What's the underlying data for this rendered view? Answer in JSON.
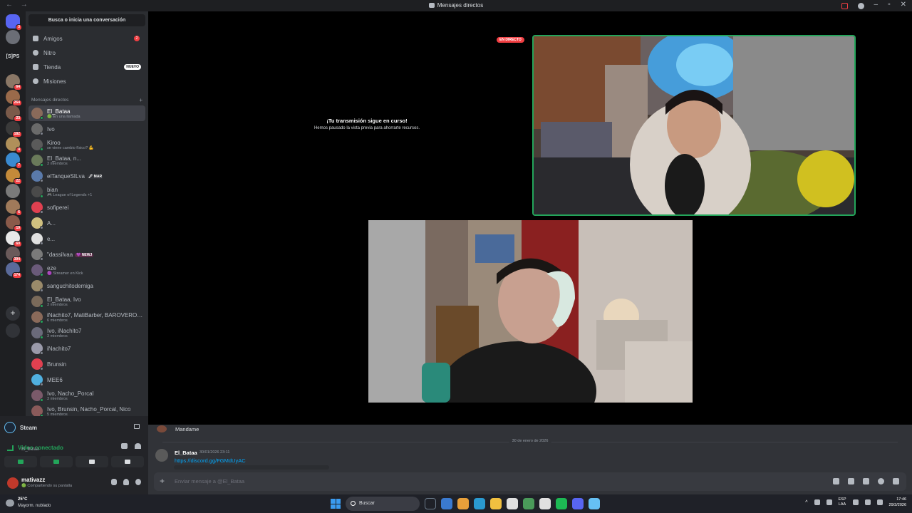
{
  "window": {
    "title": "Mensajes directos"
  },
  "servers": {
    "home_badge": "3",
    "label_text": "[S]PS",
    "items": [
      {
        "color": "#6b6e76",
        "badge": ""
      },
      {
        "color": "#8a7766",
        "badge": "64"
      },
      {
        "color": "#9a6a4a",
        "badge": "264"
      },
      {
        "color": "#7a5a4a",
        "badge": "23"
      },
      {
        "color": "#3a3a3a",
        "badge": "182"
      },
      {
        "color": "#b0905a",
        "badge": "4"
      },
      {
        "color": "#3a8ad0",
        "badge": "7"
      },
      {
        "color": "#c48a3a",
        "badge": "22"
      },
      {
        "color": "#7a7a7a",
        "badge": ""
      },
      {
        "color": "#a07a5a",
        "badge": "6"
      },
      {
        "color": "#8a5a4a",
        "badge": "19"
      },
      {
        "color": "#e8e8e8",
        "badge": "60"
      },
      {
        "color": "#6a5a5a",
        "badge": "394"
      },
      {
        "color": "#5a6a9a",
        "badge": "174"
      }
    ]
  },
  "sidebar": {
    "search_placeholder": "Busca o inicia una conversación",
    "nav": {
      "friends": "Amigos",
      "friends_count": "2",
      "nitro": "Nitro",
      "shop": "Tienda",
      "shop_badge": "NUEVO",
      "quests": "Misiones"
    },
    "dm_header": "Mensajes directos",
    "dms": [
      {
        "name": "El_Bataa",
        "sub": "🟢 En una llamada",
        "color": "#8a6a5a",
        "status": "#23a55a",
        "tag": ""
      },
      {
        "name": "Ivo",
        "sub": "",
        "color": "#6a6a6a",
        "status": "#80848e",
        "tag": ""
      },
      {
        "name": "Kiroo",
        "sub": "se viene cambio físico? 💪",
        "color": "#5a5a5a",
        "status": "#23a55a",
        "tag": ""
      },
      {
        "name": "El_Bataa, n...",
        "sub": "3 miembros",
        "color": "#6a7a5a",
        "status": "#23a55a",
        "tag": ""
      },
      {
        "name": "elTanqueSILva",
        "sub": "",
        "color": "#5a7aaa",
        "status": "#80848e",
        "tag": "🖊 MAR"
      },
      {
        "name": "bian",
        "sub": "🎮 League of Legends +1",
        "color": "#4a4a4a",
        "status": "#23a55a",
        "tag": ""
      },
      {
        "name": "sofiperei",
        "sub": "",
        "color": "#e04050",
        "status": "#80848e",
        "tag": ""
      },
      {
        "name": "A...",
        "sub": "",
        "color": "#d0c080",
        "status": "#80848e",
        "tag": ""
      },
      {
        "name": "e...",
        "sub": "",
        "color": "#e0e0e0",
        "status": "#80848e",
        "tag": ""
      },
      {
        "name": "\"dassilvaa",
        "sub": "",
        "color": "#7a7a7a",
        "status": "#80848e",
        "tag": "💜 NEWJ"
      },
      {
        "name": "eze",
        "sub": "🟣 Streamer en Kick",
        "color": "#6a5a7a",
        "status": "#23a55a",
        "tag": ""
      },
      {
        "name": "sanguchitodemiga",
        "sub": "",
        "color": "#9a8a6a",
        "status": "#80848e",
        "tag": ""
      },
      {
        "name": "El_Bataa, Ivo",
        "sub": "3 miembros",
        "color": "#7a6a5a",
        "status": "#23a55a",
        "tag": ""
      },
      {
        "name": "iNachito7, MatiBarber, BAROVERO5, ...",
        "sub": "6 miembros",
        "color": "#8a6a5a",
        "status": "#23a55a",
        "tag": ""
      },
      {
        "name": "Ivo, iNachito7",
        "sub": "3 miembros",
        "color": "#6a6a7a",
        "status": "#23a55a",
        "tag": ""
      },
      {
        "name": "iNachito7",
        "sub": "",
        "color": "#9a9aaa",
        "status": "#80848e",
        "tag": ""
      },
      {
        "name": "Brunsin",
        "sub": "",
        "color": "#e04050",
        "status": "#80848e",
        "tag": ""
      },
      {
        "name": "MEE6",
        "sub": "",
        "color": "#50b0e0",
        "status": "#80848e",
        "tag": ""
      },
      {
        "name": "Ivo, Nacho_Porcal",
        "sub": "3 miembros",
        "color": "#7a5a6a",
        "status": "#23a55a",
        "tag": ""
      },
      {
        "name": "Ivo, Brunsin, Nacho_Porcal, Nico",
        "sub": "5 miembros",
        "color": "#8a5a5a",
        "status": "#23a55a",
        "tag": ""
      }
    ]
  },
  "voice": {
    "activity": "Steam",
    "status": "Video conectado",
    "channel": "El_Bataa",
    "user": "mativazz",
    "user_status": "🟢 Compartiendo su pantalla"
  },
  "stage": {
    "paused_title": "¡Tu transmisión sigue en curso!",
    "paused_sub": "Hemos pausado la vista previa para ahorrarte recursos.",
    "live_badge": "EN DIRECTO"
  },
  "chat": {
    "prev_message": "Mandame",
    "date_divider": "30 de enero de 2026",
    "author": "El_Bataa",
    "timestamp": "30/01/2026 23:11",
    "link": "https://discord.gg/FGMdUyAC",
    "composer_placeholder": "Enviar mensaje a @El_Bataa"
  },
  "taskbar": {
    "temp": "25°C",
    "weather": "Mayorm. nublado",
    "search": "Buscar",
    "lang1": "ESP",
    "lang2": "LAA",
    "time": "17:46",
    "date": "29/3/2026",
    "apps": [
      "#6a7a8a",
      "#3a7ad0",
      "#e8a03a",
      "#2a9ad0",
      "#f0c040",
      "#e0e0e0",
      "#4a9a5a",
      "#e0e0e0",
      "#1db954",
      "#5865f2",
      "#66c0f4"
    ]
  }
}
